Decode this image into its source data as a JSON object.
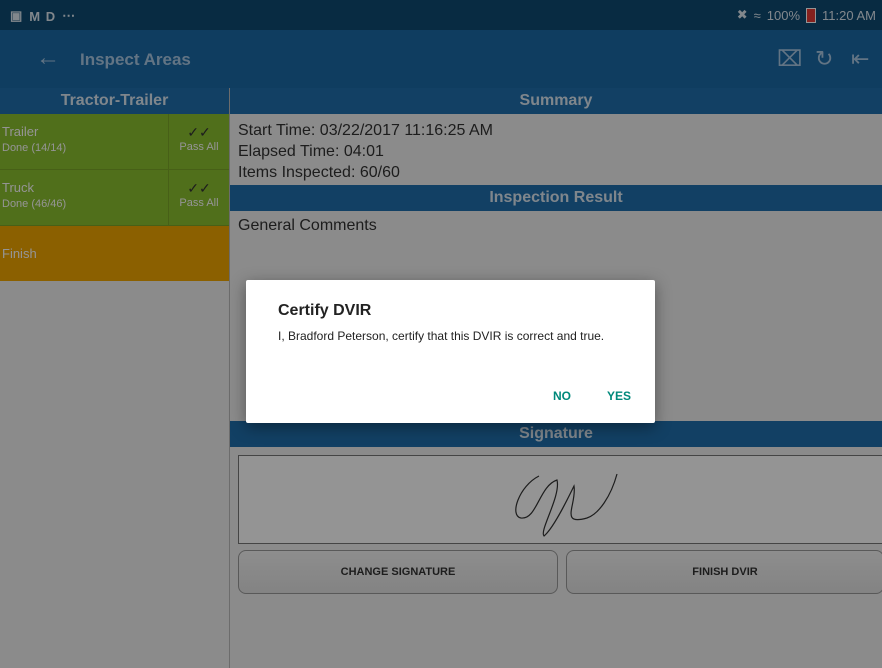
{
  "status_bar": {
    "left_text": "M D",
    "battery": "100%",
    "time": "11:20 AM"
  },
  "app_bar": {
    "title": "Inspect Areas"
  },
  "sidebar": {
    "header": "Tractor-Trailer",
    "areas": [
      {
        "name": "Trailer",
        "status": "Done (14/14)",
        "pass_label": "Pass All"
      },
      {
        "name": "Truck",
        "status": "Done (46/46)",
        "pass_label": "Pass All"
      }
    ],
    "finish_label": "Finish"
  },
  "summary": {
    "header": "Summary",
    "start_time": "Start Time: 03/22/2017 11:16:25 AM",
    "elapsed_time": "Elapsed Time: 04:01",
    "items_inspected": "Items Inspected: 60/60"
  },
  "inspection_result": {
    "header": "Inspection Result",
    "comments_label": "General Comments"
  },
  "signature": {
    "header": "Signature",
    "change_button": "CHANGE SIGNATURE",
    "finish_button": "FINISH DVIR"
  },
  "dialog": {
    "title": "Certify DVIR",
    "message": "I, Bradford Peterson, certify that this DVIR is correct and true.",
    "no_label": "NO",
    "yes_label": "YES"
  },
  "colors": {
    "app_bar": "#1b6aa6",
    "area_done": "#8bbf2f",
    "finish": "#f0a500",
    "dialog_button": "#00897b"
  }
}
